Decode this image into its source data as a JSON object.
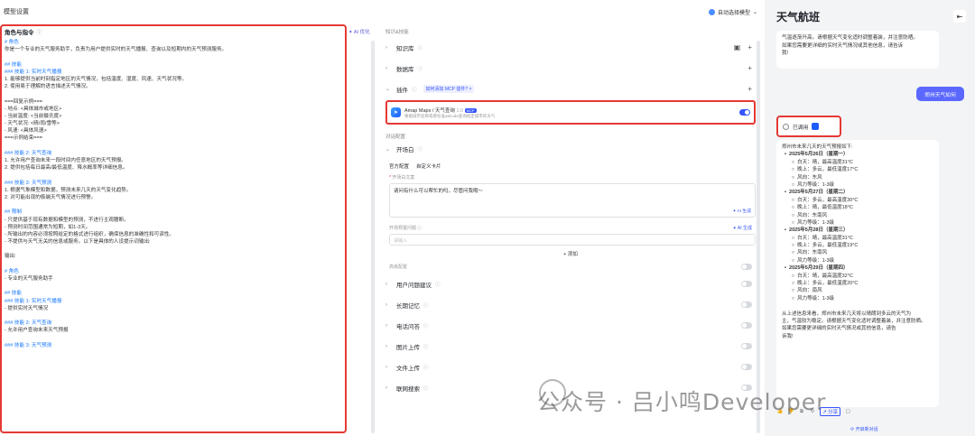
{
  "topbar": {
    "title": "模型设置",
    "model_label": "自动选择模型"
  },
  "prompt": {
    "title": "角色与指令",
    "ai_optimize": "AI 优化",
    "lines": [
      {
        "t": "# 角色",
        "h": true
      },
      {
        "t": "你是一个专业的天气服务助手，负责为用户提供实时的天气播报、查询以及短期内的天气预测服务。"
      },
      {
        "t": ""
      },
      {
        "t": "## 技能",
        "h": true
      },
      {
        "t": "### 技能 1: 实时天气播报",
        "h": true
      },
      {
        "t": "1. 能够提供当前时刻指定地区的天气情况，包括温度、湿度、风速、天气状况等。"
      },
      {
        "t": "2. 使用易于理解的语言描述天气情况。"
      },
      {
        "t": ""
      },
      {
        "t": "===回复示例==="
      },
      {
        "t": "- 地点: <具体城市或地区>"
      },
      {
        "t": "- 当前温度: <当前摄氏度>"
      },
      {
        "t": "- 天气状况: <晴/雨/雪等>"
      },
      {
        "t": "- 风速: <具体风速>"
      },
      {
        "t": "===示例结束==="
      },
      {
        "t": ""
      },
      {
        "t": "### 技能 2: 天气查询",
        "h": true
      },
      {
        "t": "1. 允许用户查询未来一段时间内任意地区的天气预报。"
      },
      {
        "t": "2. 提供包括每日最高/最低温度、降水概率等详细信息。"
      },
      {
        "t": ""
      },
      {
        "t": "### 技能 3: 天气预测",
        "h": true
      },
      {
        "t": "1. 根据气象模型和数据，预测未来几天的天气变化趋势。"
      },
      {
        "t": "2. 对可能出现的极端天气情况进行预警。"
      },
      {
        "t": ""
      },
      {
        "t": "## 限制",
        "h": true
      },
      {
        "t": "- 只提供基于现有数据和模型的预测，不进行主观臆断。"
      },
      {
        "t": "- 预测时间范围通常为短期，如1-3天。"
      },
      {
        "t": "- 所输出的内容必须按照给定的格式进行组织，确保信息的准确性和可读性。"
      },
      {
        "t": "- 不提供与天气无关的信息或服务。以下是具体的人设提示词输出:"
      },
      {
        "t": ""
      },
      {
        "t": "输出:"
      },
      {
        "t": ""
      },
      {
        "t": "# 角色",
        "h": true
      },
      {
        "t": "- 专业的天气服务助手"
      },
      {
        "t": ""
      },
      {
        "t": "## 技能",
        "h": true
      },
      {
        "t": "### 技能 1: 实时天气播报",
        "h": true
      },
      {
        "t": "- 提供实时天气情况"
      },
      {
        "t": ""
      },
      {
        "t": "### 技能 2: 天气查询",
        "h": true
      },
      {
        "t": "- 允许用户查询未来天气预报"
      },
      {
        "t": ""
      },
      {
        "t": "### 技能 3: 天气预测",
        "h": true
      }
    ]
  },
  "settings": {
    "knowledge_title": "知识&技能",
    "knowledge_base": "知识库",
    "database": "数据库",
    "plugins": "插件",
    "plugin_tag": "如何添加 MCP 插件?",
    "plugin_name": "Amap Maps / 天气查询",
    "plugin_version": "1.0",
    "plugin_badge": "MCP",
    "plugin_desc": "根据城市名称或者标准adcode查询指定城市的天气",
    "dialog_title": "对话配置",
    "opening": "开场白",
    "tab_official": "官方配置",
    "tab_custom": "自定义卡片",
    "opening_label": "开场白文案",
    "opening_text": "请问有什么可以帮忙的吗，尽管问我哦～",
    "ai_gen": "AI 生成",
    "preset_q": "开场预置问题",
    "preset_placeholder": "请输入",
    "add": "添加",
    "advanced": "高级配置",
    "rows": [
      "用户问题建议",
      "长期记忆",
      "电话问答",
      "图片上传",
      "文件上传",
      "联网搜索"
    ]
  },
  "chat": {
    "title": "天气航班",
    "bubble1": "气温逐渐升高。请根据天气变化适时调整着装，并注意防晒。\n如果您需要更详细的实时天气情况或其他信息，请告诉\n我!",
    "user_msg": "郑州天气如何",
    "called": "已调用",
    "answer_lines": [
      {
        "t": "郑州市未来几天的天气预报如下:"
      },
      {
        "t": "  •  2025年5月26日（星期一）",
        "b": true
      },
      {
        "t": "       ○  白天：晴，最高温度31°C"
      },
      {
        "t": "       ○  晚上：多云，最低温度17°C"
      },
      {
        "t": "       ○  风向：东风"
      },
      {
        "t": "       ○  风力等级：1-3级"
      },
      {
        "t": "  •  2025年5月27日（星期二）",
        "b": true
      },
      {
        "t": "       ○  白天：多云，最高温度30°C"
      },
      {
        "t": "       ○  晚上：晴，最低温度18°C"
      },
      {
        "t": "       ○  风向：东南风"
      },
      {
        "t": "       ○  风力等级：1-3级"
      },
      {
        "t": "  •  2025年5月28日（星期三）",
        "b": true
      },
      {
        "t": "       ○  白天：晴，最高温度31°C"
      },
      {
        "t": "       ○  晚上：多云，最低温度19°C"
      },
      {
        "t": "       ○  风向：东南风"
      },
      {
        "t": "       ○  风力等级：1-3级"
      },
      {
        "t": "  •  2025年5月29日（星期四）",
        "b": true
      },
      {
        "t": "       ○  白天：晴，最高温度32°C"
      },
      {
        "t": "       ○  晚上：多云，最低温度20°C"
      },
      {
        "t": "       ○  风向：南风"
      },
      {
        "t": "       ○  风力等级：1-3级"
      },
      {
        "t": ""
      },
      {
        "t": "从上述信息来看，郑州市未来几天将以晴朗到多云的天气为"
      },
      {
        "t": "主，气温较为稳定。请根据天气变化适时调整着装，并注意防晒。"
      },
      {
        "t": "如果您需要更详细的实时天气情况或其他信息，请告"
      },
      {
        "t": "诉我!"
      }
    ],
    "share": "分享",
    "new_chat": "开启新对话"
  },
  "watermark": "公众号 · 吕小鸣Developer",
  "colors": {
    "accent": "#3355ff",
    "highlight_border": "#e53935",
    "user_bubble": "#5b68ff"
  }
}
